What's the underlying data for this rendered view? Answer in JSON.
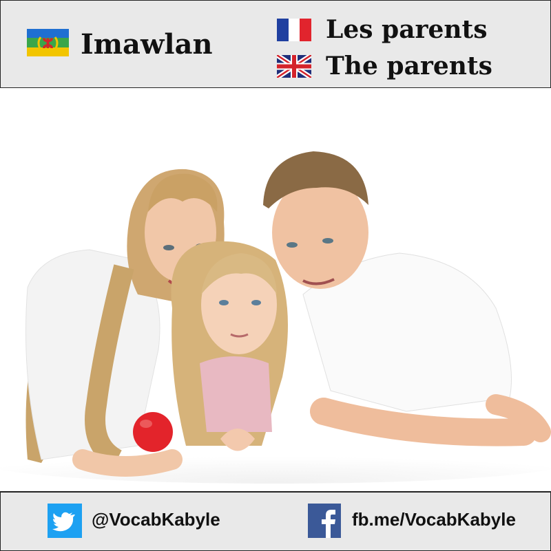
{
  "header": {
    "kabyle_word": "Imawlan",
    "french_word": "Les parents",
    "english_word": "The parents",
    "kabyle_flag_icon": "kabyle-flag-icon",
    "french_flag_icon": "french-flag-icon",
    "uk_flag_icon": "uk-flag-icon"
  },
  "photo": {
    "subject": "family-photo"
  },
  "footer": {
    "twitter_handle": "@VocabKabyle",
    "facebook_link": "fb.me/VocabKabyle",
    "twitter_icon": "twitter-icon",
    "facebook_icon": "facebook-icon"
  },
  "colors": {
    "panel_bg": "#e9e9e9",
    "border": "#222222",
    "twitter_blue": "#1da1f2",
    "facebook_blue": "#3b5998"
  }
}
